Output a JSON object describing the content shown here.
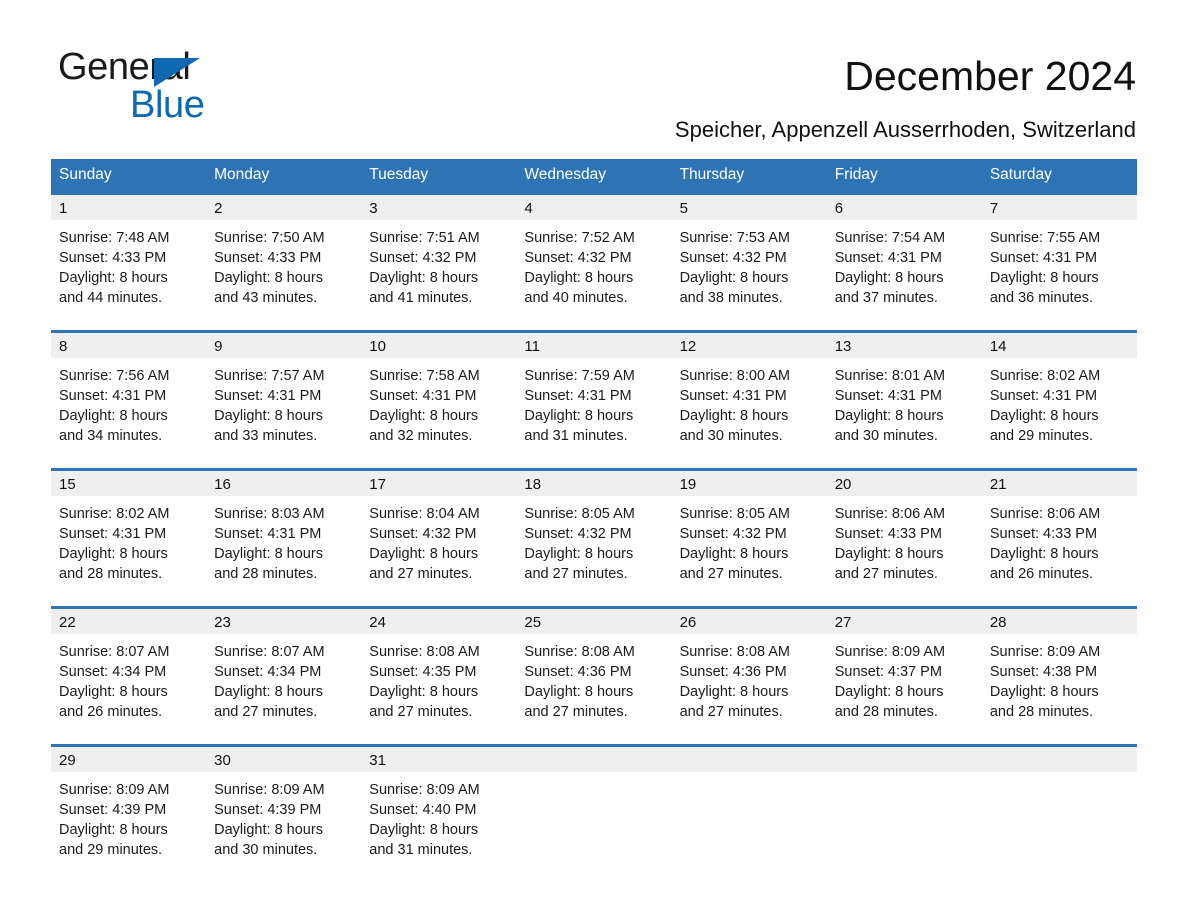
{
  "brand": {
    "name_part1": "General",
    "name_part2": "Blue",
    "triangle_color": "#1068b0"
  },
  "header": {
    "title": "December 2024",
    "subtitle": "Speicher, Appenzell Ausserrhoden, Switzerland"
  },
  "theme": {
    "header_blue": "#2e74b5",
    "date_band_gray": "#efefef",
    "text_color": "#111111"
  },
  "calendar": {
    "day_names": [
      "Sunday",
      "Monday",
      "Tuesday",
      "Wednesday",
      "Thursday",
      "Friday",
      "Saturday"
    ],
    "weeks": [
      [
        {
          "date": "1",
          "sunrise": "Sunrise: 7:48 AM",
          "sunset": "Sunset: 4:33 PM",
          "daylight_line1": "Daylight: 8 hours",
          "daylight_line2": "and 44 minutes."
        },
        {
          "date": "2",
          "sunrise": "Sunrise: 7:50 AM",
          "sunset": "Sunset: 4:33 PM",
          "daylight_line1": "Daylight: 8 hours",
          "daylight_line2": "and 43 minutes."
        },
        {
          "date": "3",
          "sunrise": "Sunrise: 7:51 AM",
          "sunset": "Sunset: 4:32 PM",
          "daylight_line1": "Daylight: 8 hours",
          "daylight_line2": "and 41 minutes."
        },
        {
          "date": "4",
          "sunrise": "Sunrise: 7:52 AM",
          "sunset": "Sunset: 4:32 PM",
          "daylight_line1": "Daylight: 8 hours",
          "daylight_line2": "and 40 minutes."
        },
        {
          "date": "5",
          "sunrise": "Sunrise: 7:53 AM",
          "sunset": "Sunset: 4:32 PM",
          "daylight_line1": "Daylight: 8 hours",
          "daylight_line2": "and 38 minutes."
        },
        {
          "date": "6",
          "sunrise": "Sunrise: 7:54 AM",
          "sunset": "Sunset: 4:31 PM",
          "daylight_line1": "Daylight: 8 hours",
          "daylight_line2": "and 37 minutes."
        },
        {
          "date": "7",
          "sunrise": "Sunrise: 7:55 AM",
          "sunset": "Sunset: 4:31 PM",
          "daylight_line1": "Daylight: 8 hours",
          "daylight_line2": "and 36 minutes."
        }
      ],
      [
        {
          "date": "8",
          "sunrise": "Sunrise: 7:56 AM",
          "sunset": "Sunset: 4:31 PM",
          "daylight_line1": "Daylight: 8 hours",
          "daylight_line2": "and 34 minutes."
        },
        {
          "date": "9",
          "sunrise": "Sunrise: 7:57 AM",
          "sunset": "Sunset: 4:31 PM",
          "daylight_line1": "Daylight: 8 hours",
          "daylight_line2": "and 33 minutes."
        },
        {
          "date": "10",
          "sunrise": "Sunrise: 7:58 AM",
          "sunset": "Sunset: 4:31 PM",
          "daylight_line1": "Daylight: 8 hours",
          "daylight_line2": "and 32 minutes."
        },
        {
          "date": "11",
          "sunrise": "Sunrise: 7:59 AM",
          "sunset": "Sunset: 4:31 PM",
          "daylight_line1": "Daylight: 8 hours",
          "daylight_line2": "and 31 minutes."
        },
        {
          "date": "12",
          "sunrise": "Sunrise: 8:00 AM",
          "sunset": "Sunset: 4:31 PM",
          "daylight_line1": "Daylight: 8 hours",
          "daylight_line2": "and 30 minutes."
        },
        {
          "date": "13",
          "sunrise": "Sunrise: 8:01 AM",
          "sunset": "Sunset: 4:31 PM",
          "daylight_line1": "Daylight: 8 hours",
          "daylight_line2": "and 30 minutes."
        },
        {
          "date": "14",
          "sunrise": "Sunrise: 8:02 AM",
          "sunset": "Sunset: 4:31 PM",
          "daylight_line1": "Daylight: 8 hours",
          "daylight_line2": "and 29 minutes."
        }
      ],
      [
        {
          "date": "15",
          "sunrise": "Sunrise: 8:02 AM",
          "sunset": "Sunset: 4:31 PM",
          "daylight_line1": "Daylight: 8 hours",
          "daylight_line2": "and 28 minutes."
        },
        {
          "date": "16",
          "sunrise": "Sunrise: 8:03 AM",
          "sunset": "Sunset: 4:31 PM",
          "daylight_line1": "Daylight: 8 hours",
          "daylight_line2": "and 28 minutes."
        },
        {
          "date": "17",
          "sunrise": "Sunrise: 8:04 AM",
          "sunset": "Sunset: 4:32 PM",
          "daylight_line1": "Daylight: 8 hours",
          "daylight_line2": "and 27 minutes."
        },
        {
          "date": "18",
          "sunrise": "Sunrise: 8:05 AM",
          "sunset": "Sunset: 4:32 PM",
          "daylight_line1": "Daylight: 8 hours",
          "daylight_line2": "and 27 minutes."
        },
        {
          "date": "19",
          "sunrise": "Sunrise: 8:05 AM",
          "sunset": "Sunset: 4:32 PM",
          "daylight_line1": "Daylight: 8 hours",
          "daylight_line2": "and 27 minutes."
        },
        {
          "date": "20",
          "sunrise": "Sunrise: 8:06 AM",
          "sunset": "Sunset: 4:33 PM",
          "daylight_line1": "Daylight: 8 hours",
          "daylight_line2": "and 27 minutes."
        },
        {
          "date": "21",
          "sunrise": "Sunrise: 8:06 AM",
          "sunset": "Sunset: 4:33 PM",
          "daylight_line1": "Daylight: 8 hours",
          "daylight_line2": "and 26 minutes."
        }
      ],
      [
        {
          "date": "22",
          "sunrise": "Sunrise: 8:07 AM",
          "sunset": "Sunset: 4:34 PM",
          "daylight_line1": "Daylight: 8 hours",
          "daylight_line2": "and 26 minutes."
        },
        {
          "date": "23",
          "sunrise": "Sunrise: 8:07 AM",
          "sunset": "Sunset: 4:34 PM",
          "daylight_line1": "Daylight: 8 hours",
          "daylight_line2": "and 27 minutes."
        },
        {
          "date": "24",
          "sunrise": "Sunrise: 8:08 AM",
          "sunset": "Sunset: 4:35 PM",
          "daylight_line1": "Daylight: 8 hours",
          "daylight_line2": "and 27 minutes."
        },
        {
          "date": "25",
          "sunrise": "Sunrise: 8:08 AM",
          "sunset": "Sunset: 4:36 PM",
          "daylight_line1": "Daylight: 8 hours",
          "daylight_line2": "and 27 minutes."
        },
        {
          "date": "26",
          "sunrise": "Sunrise: 8:08 AM",
          "sunset": "Sunset: 4:36 PM",
          "daylight_line1": "Daylight: 8 hours",
          "daylight_line2": "and 27 minutes."
        },
        {
          "date": "27",
          "sunrise": "Sunrise: 8:09 AM",
          "sunset": "Sunset: 4:37 PM",
          "daylight_line1": "Daylight: 8 hours",
          "daylight_line2": "and 28 minutes."
        },
        {
          "date": "28",
          "sunrise": "Sunrise: 8:09 AM",
          "sunset": "Sunset: 4:38 PM",
          "daylight_line1": "Daylight: 8 hours",
          "daylight_line2": "and 28 minutes."
        }
      ],
      [
        {
          "date": "29",
          "sunrise": "Sunrise: 8:09 AM",
          "sunset": "Sunset: 4:39 PM",
          "daylight_line1": "Daylight: 8 hours",
          "daylight_line2": "and 29 minutes."
        },
        {
          "date": "30",
          "sunrise": "Sunrise: 8:09 AM",
          "sunset": "Sunset: 4:39 PM",
          "daylight_line1": "Daylight: 8 hours",
          "daylight_line2": "and 30 minutes."
        },
        {
          "date": "31",
          "sunrise": "Sunrise: 8:09 AM",
          "sunset": "Sunset: 4:40 PM",
          "daylight_line1": "Daylight: 8 hours",
          "daylight_line2": "and 31 minutes."
        },
        {
          "date": "",
          "sunrise": "",
          "sunset": "",
          "daylight_line1": "",
          "daylight_line2": ""
        },
        {
          "date": "",
          "sunrise": "",
          "sunset": "",
          "daylight_line1": "",
          "daylight_line2": ""
        },
        {
          "date": "",
          "sunrise": "",
          "sunset": "",
          "daylight_line1": "",
          "daylight_line2": ""
        },
        {
          "date": "",
          "sunrise": "",
          "sunset": "",
          "daylight_line1": "",
          "daylight_line2": ""
        }
      ]
    ]
  }
}
